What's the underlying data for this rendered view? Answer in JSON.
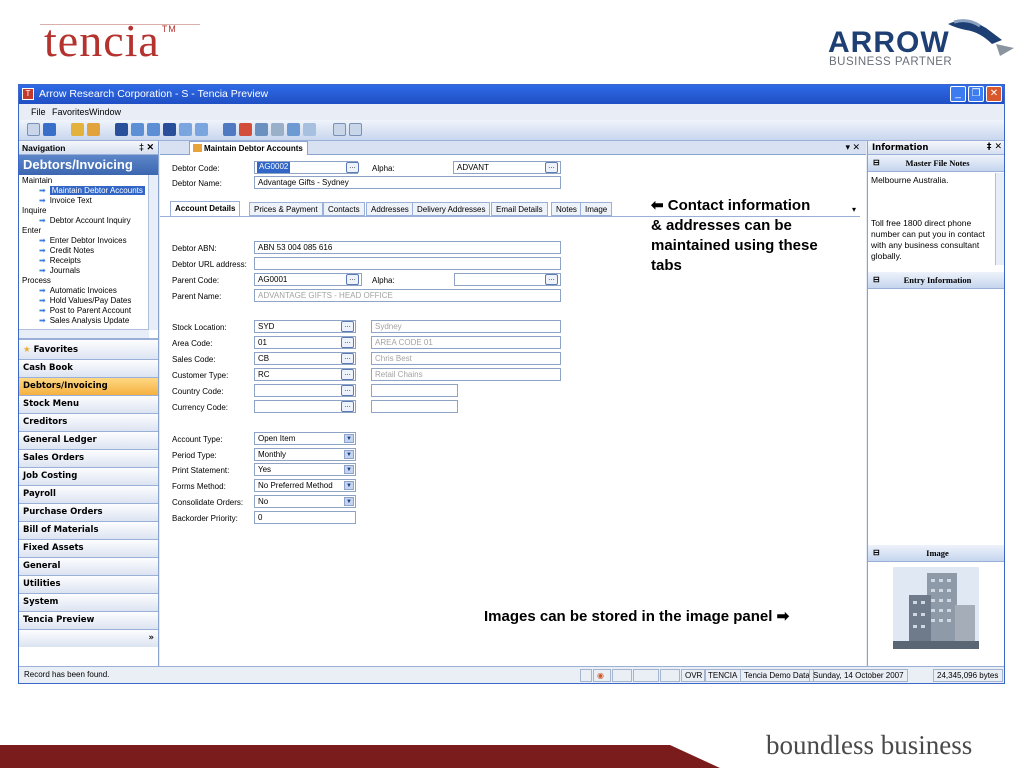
{
  "slide": {
    "logo_left": "tencia",
    "logo_left_tm": "TM",
    "logo_right": "ARROW",
    "logo_right_sub": "BUSINESS PARTNER",
    "tagline": "boundless business",
    "callout_tabs": "⬅ Contact information & addresses can be maintained using these tabs",
    "callout_image": "Images can be stored in the image panel ➡"
  },
  "window": {
    "title": "Arrow Research Corporation - S - Tencia Preview",
    "menu": [
      "File",
      "Favorites",
      "Window"
    ]
  },
  "navigation": {
    "header": "Navigation",
    "title": "Debtors/Invoicing",
    "tree": [
      {
        "label": "Maintain",
        "level": 0
      },
      {
        "label": "Maintain Debtor Accounts",
        "level": 1,
        "selected": true
      },
      {
        "label": "Invoice Text",
        "level": 1
      },
      {
        "label": "Inquire",
        "level": 0
      },
      {
        "label": "Debtor Account Inquiry",
        "level": 1
      },
      {
        "label": "Enter",
        "level": 0
      },
      {
        "label": "Enter Debtor Invoices",
        "level": 1
      },
      {
        "label": "Credit Notes",
        "level": 1
      },
      {
        "label": "Receipts",
        "level": 1
      },
      {
        "label": "Journals",
        "level": 1
      },
      {
        "label": "Process",
        "level": 0
      },
      {
        "label": "Automatic Invoices",
        "level": 1
      },
      {
        "label": "Hold Values/Pay Dates",
        "level": 1
      },
      {
        "label": "Post to Parent Account",
        "level": 1
      },
      {
        "label": "Sales Analysis Update",
        "level": 1
      }
    ],
    "favorites": "Favorites",
    "modules": [
      "Cash Book",
      "Debtors/Invoicing",
      "Stock Menu",
      "Creditors",
      "General Ledger",
      "Sales Orders",
      "Job Costing",
      "Payroll",
      "Purchase Orders",
      "Bill of Materials",
      "Fixed Assets",
      "General",
      "Utilities",
      "System",
      "Tencia Preview"
    ],
    "active_module": "Debtors/Invoicing"
  },
  "document": {
    "tab": "Maintain Debtor Accounts",
    "debtor_code_label": "Debtor Code:",
    "debtor_code": "AG0002",
    "alpha_label": "Alpha:",
    "alpha": "ADVANT",
    "debtor_name_label": "Debtor Name:",
    "debtor_name": "Advantage Gifts - Sydney",
    "tabs": [
      "Account Details",
      "Prices & Payment",
      "Contacts",
      "Addresses",
      "Delivery Addresses",
      "Email Details",
      "Notes",
      "Image"
    ],
    "abn_label": "Debtor ABN:",
    "abn": "ABN 53 004 085 616",
    "url_label": "Debtor URL address:",
    "parent_code_label": "Parent Code:",
    "parent_code": "AG0001",
    "parent_alpha_label": "Alpha:",
    "parent_name_label": "Parent Name:",
    "parent_name": "ADVANTAGE GIFTS - HEAD OFFICE",
    "stock_location_label": "Stock Location:",
    "stock_location": "SYD",
    "stock_location_desc": "Sydney",
    "area_code_label": "Area Code:",
    "area_code": "01",
    "area_code_desc": "AREA CODE 01",
    "sales_code_label": "Sales Code:",
    "sales_code": "CB",
    "sales_code_desc": "Chris Best",
    "customer_type_label": "Customer Type:",
    "customer_type": "RC",
    "customer_type_desc": "Retail Chains",
    "country_code_label": "Country Code:",
    "currency_code_label": "Currency Code:",
    "account_type_label": "Account Type:",
    "account_type": "Open Item",
    "period_type_label": "Period Type:",
    "period_type": "Monthly",
    "print_statement_label": "Print Statement:",
    "print_statement": "Yes",
    "forms_method_label": "Forms Method:",
    "forms_method": "No Preferred Method",
    "consolidate_label": "Consolidate Orders:",
    "consolidate": "No",
    "backorder_label": "Backorder Priority:",
    "backorder": "0"
  },
  "info": {
    "header": "Information",
    "master_file_notes": "Master File Notes",
    "note1": "Melbourne Australia.",
    "note2": "Toll free 1800 direct phone number can put you in contact with any business consultant globally.",
    "entry_information": "Entry Information",
    "image": "Image"
  },
  "status": {
    "message": "Record has been found.",
    "ovr": "OVR",
    "company": "TENCIA",
    "database": "Tencia Demo Data",
    "date": "Sunday, 14 October 2007",
    "memory": "24,345,096 bytes"
  },
  "colors": {
    "tencia_red": "#b5332e",
    "arrow_navy": "#1e3f73",
    "bar_dark_red": "#7a1c1c",
    "titlebar_blue": "#2f6ae6",
    "active_module_orange": "#f5b040"
  }
}
